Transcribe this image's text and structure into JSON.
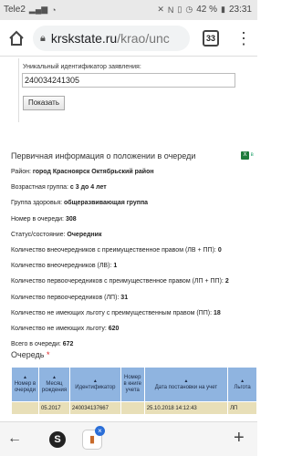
{
  "statusbar": {
    "carrier": "Tele2",
    "battery": "42 %",
    "time": "23:31"
  },
  "browser": {
    "url_host": "krskstate.ru",
    "url_path": "/krao/unc",
    "tab_count": "33"
  },
  "form": {
    "id_label": "Уникальный идентификатор заявления:",
    "id_value": "240034241305",
    "show_button": "Показать"
  },
  "section": {
    "title": "Первичная информация о положении в очереди",
    "excel_label": "в"
  },
  "info": [
    {
      "label": "Район: ",
      "value": "город Красноярск Октябрьский район"
    },
    {
      "label": "Возрастная группа: ",
      "value": "с 3 до 4 лет"
    },
    {
      "label": "Группа здоровья: ",
      "value": "общеразвивающая группа"
    },
    {
      "label": "Номер в очереди: ",
      "value": "308"
    },
    {
      "label": "Статус/состояние: ",
      "value": "Очередник"
    },
    {
      "label": "Количество внеочередников с преимущественное правом (ЛВ + ПП): ",
      "value": "0"
    },
    {
      "label": "Количество внеочередников (ЛВ): ",
      "value": "1"
    },
    {
      "label": "Количество первоочередников с преимущественное правом (ЛП + ПП): ",
      "value": "2"
    },
    {
      "label": "Количество первоочередников (ЛП): ",
      "value": "31"
    },
    {
      "label": "Количество не имеющих льготу с преимущественным правом (ПП): ",
      "value": "18"
    },
    {
      "label": "Количество не имеющих льготу: ",
      "value": "620"
    },
    {
      "label": "Всего в очереди: ",
      "value": "672"
    }
  ],
  "queue": {
    "title": "Очередь",
    "required_mark": "*",
    "columns": [
      "Номер в очереди",
      "Месяц рождения",
      "Идентификатор",
      "Номер в книге учета",
      "Дата постановки на учет",
      "Льгота"
    ],
    "rows": [
      [
        "",
        "05.2017",
        "240034137667",
        "",
        "25.10.2018 14:12:43",
        "ЛП"
      ]
    ]
  }
}
